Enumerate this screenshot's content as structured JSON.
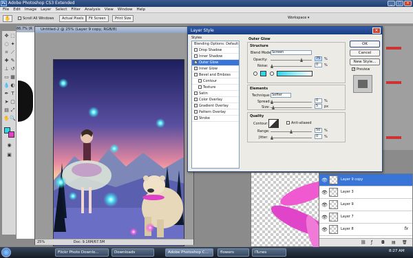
{
  "app": {
    "title": "Adobe Photoshop CS3 Extended",
    "logo_text": "Ps",
    "minimize": "_",
    "maximize": "□",
    "close": "✕"
  },
  "menu": [
    "File",
    "Edit",
    "Image",
    "Layer",
    "Select",
    "Filter",
    "Analysis",
    "View",
    "Window",
    "Help"
  ],
  "options": {
    "scroll_all": "Scroll All Windows",
    "actual_pixels": "Actual Pixels",
    "fit_screen": "Fit Screen",
    "print_size": "Print Size",
    "workspace": "Workspace ▾"
  },
  "document": {
    "title": "Untitled-2 @ 25% (Layer 9 copy, RGB/8)",
    "zoom": "25%",
    "doc_size": "Doc: 9.16M/67.5M",
    "bg_zoom": "86.7% (R"
  },
  "dialog": {
    "title": "Layer Style",
    "styles_header": "Styles",
    "blending": "Blending Options: Default",
    "items": [
      {
        "label": "Drop Shadow",
        "checked": false,
        "selected": false
      },
      {
        "label": "Inner Shadow",
        "checked": false,
        "selected": false
      },
      {
        "label": "Outer Glow",
        "checked": true,
        "selected": true
      },
      {
        "label": "Inner Glow",
        "checked": false,
        "selected": false
      },
      {
        "label": "Bevel and Emboss",
        "checked": false,
        "selected": false
      },
      {
        "label": "Contour",
        "checked": false,
        "selected": false,
        "indent": true
      },
      {
        "label": "Texture",
        "checked": false,
        "selected": false,
        "indent": true
      },
      {
        "label": "Satin",
        "checked": false,
        "selected": false
      },
      {
        "label": "Color Overlay",
        "checked": false,
        "selected": false
      },
      {
        "label": "Gradient Overlay",
        "checked": false,
        "selected": false
      },
      {
        "label": "Pattern Overlay",
        "checked": false,
        "selected": false
      },
      {
        "label": "Stroke",
        "checked": false,
        "selected": false
      }
    ],
    "outer_glow": {
      "heading": "Outer Glow",
      "structure": "Structure",
      "blend_mode_label": "Blend Mode:",
      "blend_mode": "Screen",
      "opacity_label": "Opacity:",
      "opacity": "75",
      "noise_label": "Noise:",
      "noise": "0",
      "percent": "%",
      "elements": "Elements",
      "technique_label": "Technique:",
      "technique": "Softer",
      "spread_label": "Spread:",
      "spread": "0",
      "size_label": "Size:",
      "size": "5",
      "px": "px",
      "quality": "Quality",
      "contour_label": "Contour:",
      "anti_aliased": "Anti-aliased",
      "range_label": "Range:",
      "range": "50",
      "jitter_label": "Jitter:",
      "jitter": "0",
      "glow_color": "#2fd6e8"
    },
    "buttons": {
      "ok": "OK",
      "cancel": "Cancel",
      "new_style": "New Style...",
      "preview": "Preview"
    }
  },
  "layers": [
    {
      "name": "Layer 9 copy",
      "selected": true
    },
    {
      "name": "Layer 3",
      "selected": false
    },
    {
      "name": "Layer 9",
      "selected": false
    },
    {
      "name": "Layer 7",
      "selected": false
    },
    {
      "name": "Layer 8",
      "selected": false
    }
  ],
  "layers_fx": "fx",
  "taskbar": {
    "items": [
      "Flickr Photo Downlo...",
      "Downloads",
      "Adobe Photoshop C...",
      "flowers",
      "iTunes"
    ],
    "active_index": 2,
    "time": "8:27 AM"
  }
}
